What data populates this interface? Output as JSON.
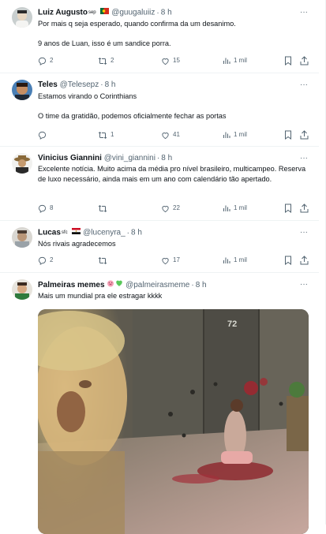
{
  "tweets": [
    {
      "name": "Luiz Augusto",
      "badge": "sep",
      "handle": "@guugaluiiz",
      "time": "8 h",
      "text": "Por mais q seja esperado, quando confirma da um desanimo.\n\n9 anos de Luan, isso é um sandice porra.",
      "replies": "2",
      "retweets": "2",
      "likes": "15",
      "views": "1 mil"
    },
    {
      "name": "Teles",
      "handle": "@Telesepz",
      "time": "8 h",
      "text": "Estamos virando o Corinthians\n\nO time da gratidão, podemos oficialmente fechar as portas",
      "replies": "",
      "retweets": "1",
      "likes": "41",
      "views": "1 mil"
    },
    {
      "name": "Vinicius Giannini",
      "handle": "@vini_giannini",
      "time": "8 h",
      "text": "Excelente notícia. Muito acima da média pro nível brasileiro, multicampeo. Reserva de luxo necessário, ainda mais em um ano com calendário tão apertado.",
      "replies": "8",
      "retweets": "",
      "likes": "22",
      "views": "1 mil"
    },
    {
      "name": "Lucas",
      "badge": "sfc",
      "handle": "@lucenyra_",
      "time": "8 h",
      "text": "Nós rivais agradecemos",
      "replies": "2",
      "retweets": "",
      "likes": "17",
      "views": "1 mil"
    },
    {
      "name": "Palmeiras memes",
      "handle": "@palmeirasmeme",
      "time": "8 h",
      "text": "Mais um mundial pra ele estragar kkkk",
      "media_label": "72"
    }
  ],
  "icons": {
    "reply": "reply-icon",
    "retweet": "retweet-icon",
    "like": "heart-icon",
    "views": "views-icon",
    "bookmark": "bookmark-icon",
    "share": "share-icon",
    "more": "more-icon"
  },
  "colors": {
    "text": "#0f1419",
    "muted": "#536471",
    "divider": "#eff3f4"
  }
}
